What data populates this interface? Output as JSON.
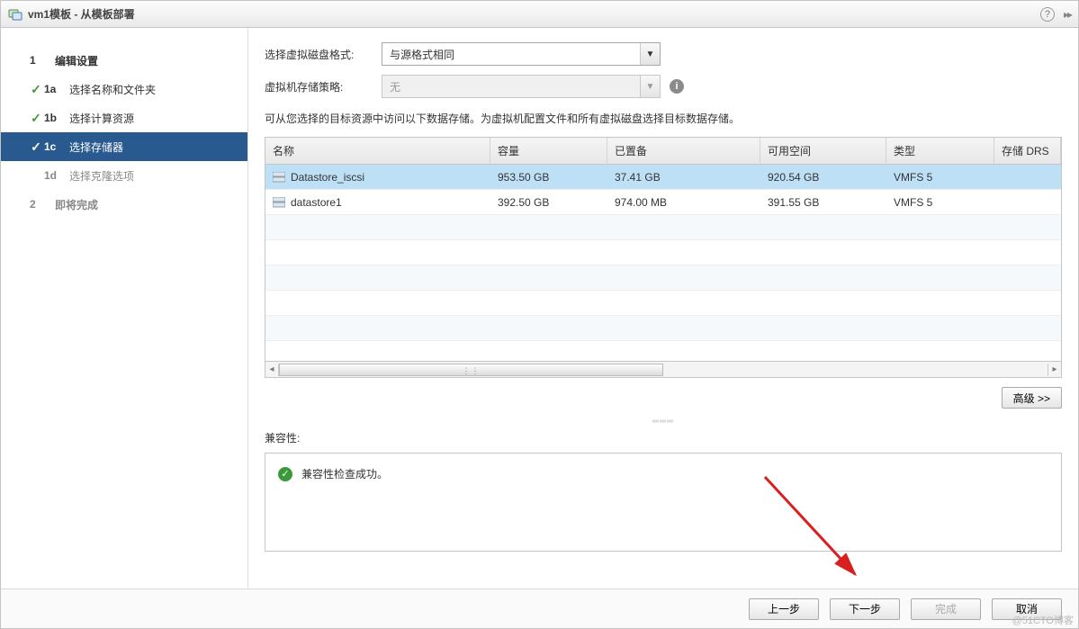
{
  "title": "vm1模板 - 从模板部署",
  "sidebar": {
    "steps": [
      {
        "num": "1",
        "label": "编辑设置",
        "section": true,
        "sub": false,
        "checked": false,
        "active": false,
        "disabled": false
      },
      {
        "num": "1a",
        "label": "选择名称和文件夹",
        "section": false,
        "sub": true,
        "checked": true,
        "active": false,
        "disabled": false
      },
      {
        "num": "1b",
        "label": "选择计算资源",
        "section": false,
        "sub": true,
        "checked": true,
        "active": false,
        "disabled": false
      },
      {
        "num": "1c",
        "label": "选择存储器",
        "section": false,
        "sub": true,
        "checked": true,
        "active": true,
        "disabled": false
      },
      {
        "num": "1d",
        "label": "选择克隆选项",
        "section": false,
        "sub": true,
        "checked": false,
        "active": false,
        "disabled": true
      },
      {
        "num": "2",
        "label": "即将完成",
        "section": true,
        "sub": false,
        "checked": false,
        "active": false,
        "disabled": true
      }
    ]
  },
  "form": {
    "disk_format_label": "选择虚拟磁盘格式:",
    "disk_format_value": "与源格式相同",
    "storage_policy_label": "虚拟机存储策略:",
    "storage_policy_value": "无",
    "description": "可从您选择的目标资源中访问以下数据存储。为虚拟机配置文件和所有虚拟磁盘选择目标数据存储。"
  },
  "table": {
    "headers": [
      "名称",
      "容量",
      "已置备",
      "可用空间",
      "类型",
      "存储 DRS"
    ],
    "rows": [
      {
        "name": "Datastore_iscsi",
        "capacity": "953.50 GB",
        "provisioned": "37.41 GB",
        "free": "920.54 GB",
        "type": "VMFS 5",
        "drs": "",
        "selected": true
      },
      {
        "name": "datastore1",
        "capacity": "392.50 GB",
        "provisioned": "974.00 MB",
        "free": "391.55 GB",
        "type": "VMFS 5",
        "drs": "",
        "selected": false
      }
    ]
  },
  "buttons": {
    "advanced": "高级 >>",
    "back": "上一步",
    "next": "下一步",
    "finish": "完成",
    "cancel": "取消"
  },
  "compat": {
    "label": "兼容性:",
    "message": "兼容性检查成功。"
  },
  "watermark": "@51CTO博客"
}
